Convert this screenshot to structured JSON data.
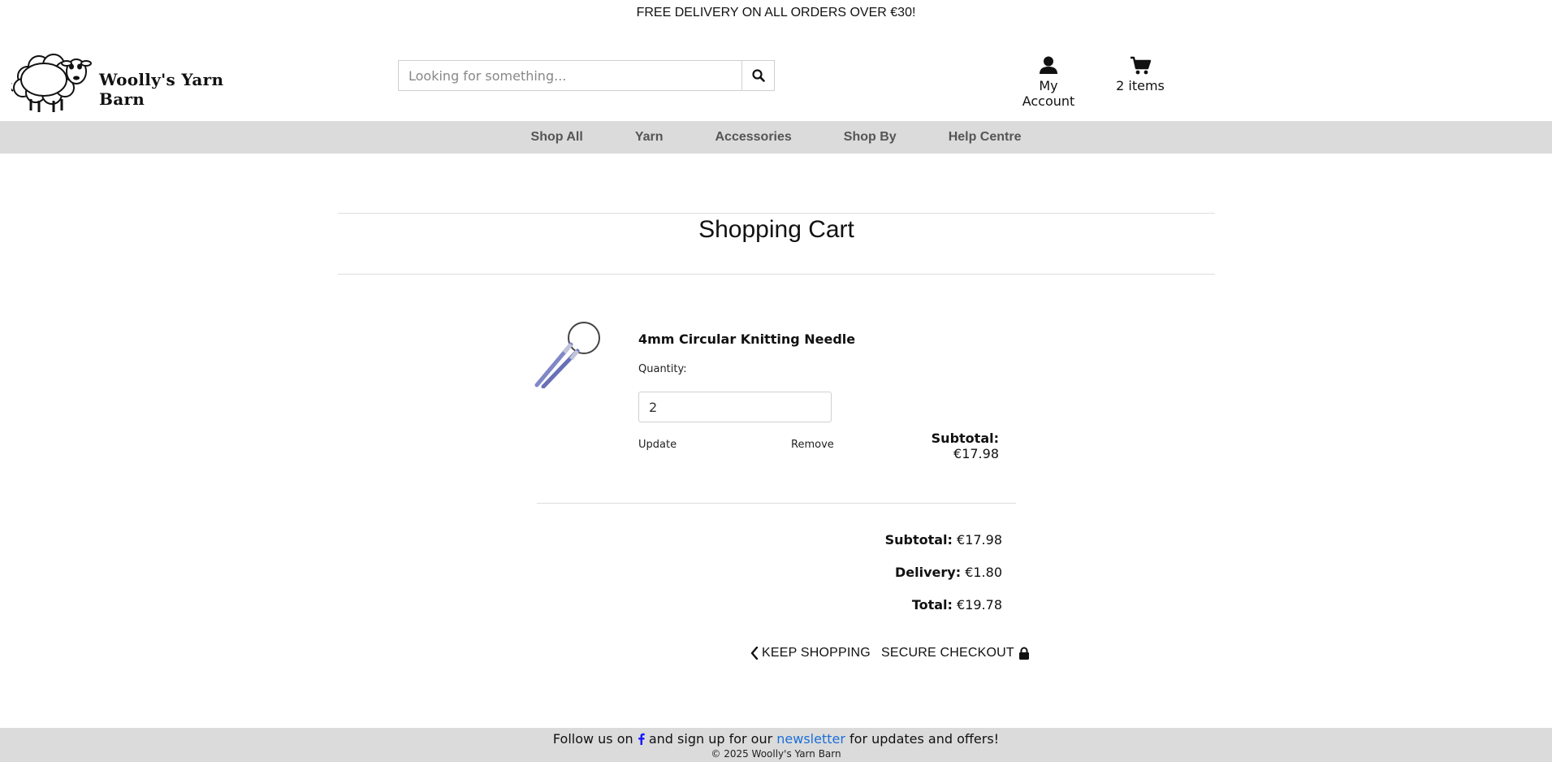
{
  "banner": {
    "text": "FREE DELIVERY ON ALL ORDERS OVER €30!"
  },
  "header": {
    "logo_text": "Woolly's Yarn Barn",
    "search": {
      "placeholder": "Looking for something..."
    },
    "account_label": "My Account",
    "cart_label": "2 items"
  },
  "nav": {
    "items": [
      {
        "label": "Shop All"
      },
      {
        "label": "Yarn"
      },
      {
        "label": "Accessories"
      },
      {
        "label": "Shop By"
      },
      {
        "label": "Help Centre"
      }
    ]
  },
  "main": {
    "title": "Shopping Cart",
    "item": {
      "name": "4mm Circular Knitting Needle",
      "quantity_label": "Quantity:",
      "quantity_value": "2",
      "update_label": "Update",
      "remove_label": "Remove",
      "subtotal_label": "Subtotal:",
      "subtotal_value": "€17.98"
    },
    "summary": {
      "subtotal_label": "Subtotal:",
      "subtotal_value": "€17.98",
      "delivery_label": "Delivery:",
      "delivery_value": "€1.80",
      "total_label": "Total:",
      "total_value": "€19.78"
    },
    "keep_shopping_label": "KEEP SHOPPING",
    "checkout_label": "SECURE CHECKOUT"
  },
  "footer": {
    "follow_prefix": "Follow us on",
    "follow_middle": "and sign up for our",
    "newsletter_link": "newsletter",
    "follow_suffix": "for updates and offers!",
    "copyright": "© 2025 Woolly's Yarn Barn"
  },
  "colors": {
    "nav_bg": "#dcdbdb",
    "link_blue": "#1a6fd8",
    "facebook_blue": "#1a1aff"
  }
}
